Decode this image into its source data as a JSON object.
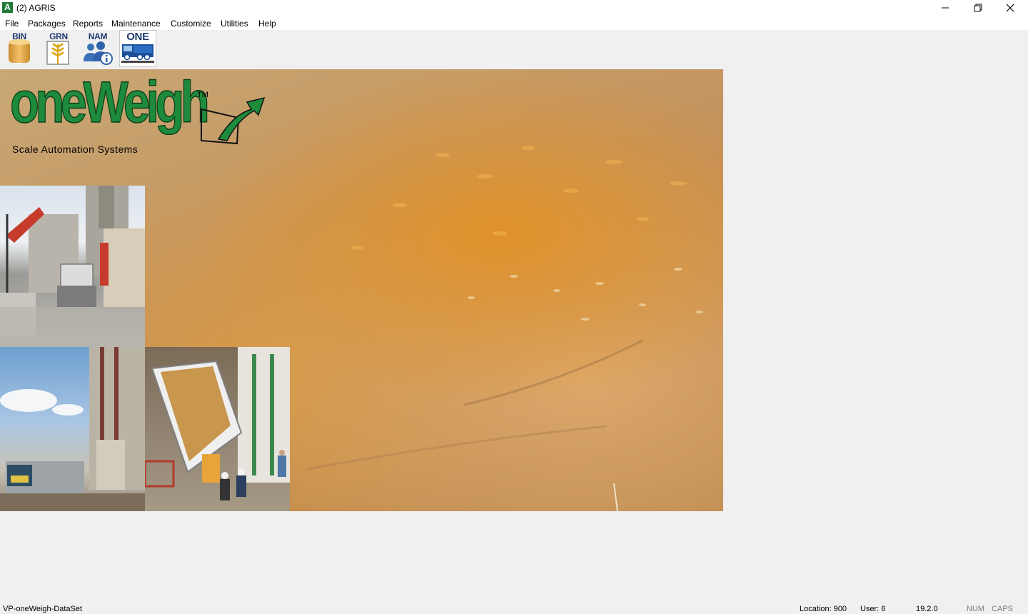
{
  "window": {
    "title": "(2) AGRIS",
    "app_icon_letter": "A"
  },
  "menu": {
    "items": [
      "File",
      "Packages",
      "Reports",
      "Maintenance",
      "Customize",
      "Utilities",
      "Help"
    ]
  },
  "toolbar": {
    "buttons": [
      {
        "label": "BIN",
        "icon": "grain-bin-icon"
      },
      {
        "label": "GRN",
        "icon": "wheat-grain-icon"
      },
      {
        "label": "NAM",
        "icon": "people-info-icon"
      },
      {
        "label": "ONE",
        "icon": "truck-scale-icon",
        "active": true
      }
    ]
  },
  "splash": {
    "logo_text": "oneWeigh",
    "trademark": "TM",
    "tagline": "Scale Automation Systems",
    "colors": {
      "logo_green": "#1e8a3c",
      "grain": "#d99a3a"
    }
  },
  "status": {
    "dataset": "VP-oneWeigh-DataSet",
    "location": "Location: 900",
    "user": "User: 6",
    "version": "19.2.0",
    "num": "NUM",
    "caps": "CAPS"
  }
}
